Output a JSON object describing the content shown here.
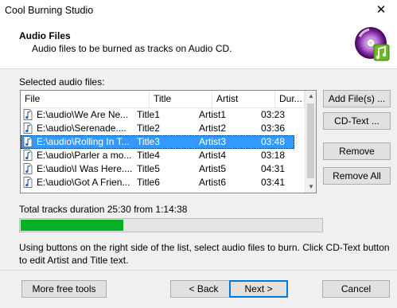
{
  "window": {
    "title": "Cool Burning Studio",
    "close_glyph": "✕"
  },
  "header": {
    "title": "Audio Files",
    "subtitle": "Audio files to be burned as tracks on Audio CD.",
    "icon": "cd-music-icon"
  },
  "list": {
    "label": "Selected audio files:",
    "columns": [
      "File",
      "Title",
      "Artist",
      "Duration"
    ],
    "column_labels_shown": [
      "File",
      "Title",
      "Artist",
      "Dur..."
    ],
    "rows": [
      {
        "file": "E:\\audio\\We Are Ne...",
        "title": "Title1",
        "artist": "Artist1",
        "duration": "03:23",
        "selected": false
      },
      {
        "file": "E:\\audio\\Serenade....",
        "title": "Title2",
        "artist": "Artist2",
        "duration": "03:36",
        "selected": false
      },
      {
        "file": "E:\\audio\\Rolling In T...",
        "title": "Title3",
        "artist": "Artist3",
        "duration": "03:48",
        "selected": true
      },
      {
        "file": "E:\\audio\\Parler a mo...",
        "title": "Title4",
        "artist": "Artist4",
        "duration": "03:18",
        "selected": false
      },
      {
        "file": "E:\\audio\\I Was Here....",
        "title": "Title5",
        "artist": "Artist5",
        "duration": "04:31",
        "selected": false
      },
      {
        "file": "E:\\audio\\Got A Frien...",
        "title": "Title6",
        "artist": "Artist6",
        "duration": "03:41",
        "selected": false
      }
    ]
  },
  "side_buttons": {
    "add_files": "Add File(s) ...",
    "cd_text": "CD-Text ...",
    "remove": "Remove",
    "remove_all": "Remove All"
  },
  "total": {
    "text": "Total tracks duration 25:30 from 1:14:38",
    "progress_fraction": 0.342
  },
  "hint": "Using buttons on the right side of the list, select audio files to burn. Click CD-Text button to edit Artist and Title text.",
  "footer": {
    "more_tools": "More free tools",
    "back": "< Back",
    "next": "Next >",
    "cancel": "Cancel"
  },
  "colors": {
    "selection": "#3399ff",
    "progress": "#06b025",
    "default_button_border": "#0078d7"
  }
}
